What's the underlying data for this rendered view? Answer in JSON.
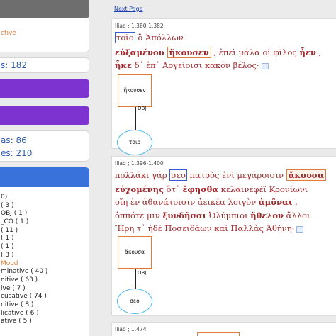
{
  "sidebar": {
    "active_label": "ctive",
    "count_label": "s: 182",
    "stats": [
      "as: 86",
      "es: 210"
    ],
    "facets": [
      "0)",
      "( 3 )",
      "OBJ ( 1 )",
      "_CO ( 1 )",
      "( 11 )",
      "( 1 )",
      "( 1 )",
      "( 3 )",
      "Mood",
      "minative ( 40 )",
      "nitive ( 63 )",
      "ive ( 7 )",
      "cusative ( 74 )",
      "nitive ( 8 )",
      "licative ( 6 )",
      "ative ( 5 )"
    ]
  },
  "main": {
    "next_page": "Next Page",
    "results": [
      {
        "ref": "Iliad ; 1.380-1.382",
        "lines": [
          {
            "parts": [
              {
                "t": "τοῖο",
                "s": "bx"
              },
              {
                "t": " ὃ Ἀπόλλων",
                "s": ""
              }
            ]
          },
          {
            "parts": [
              {
                "t": "εὐξαμένου ",
                "s": "b"
              },
              {
                "t": "ἤκουσεν",
                "s": "ob-b"
              },
              {
                "t": " , ἐπεὶ μάλα οἱ φίλος ",
                "s": ""
              },
              {
                "t": "ἦεν",
                "s": "b"
              },
              {
                "t": " ,",
                "s": ""
              }
            ]
          },
          {
            "parts": [
              {
                "t": "ἧκε",
                "s": "b"
              },
              {
                "t": " δ᾽ ἐπ᾽ Ἀργείοισι κακὸν βέλος·",
                "s": ""
              }
            ]
          }
        ],
        "tree": {
          "head": "ἤκουσεν",
          "relation": "OBJ",
          "dependent": "τοῖο"
        }
      },
      {
        "ref": "Iliad ; 1.396-1.400",
        "lines": [
          {
            "parts": [
              {
                "t": "πολλάκι γάρ ",
                "s": ""
              },
              {
                "t": "σεο",
                "s": "bx"
              },
              {
                "t": " πατρὸς ἐνὶ μεγάροισιν ",
                "s": ""
              },
              {
                "t": "ἄκουσα",
                "s": "obf-b"
              }
            ]
          },
          {
            "parts": [
              {
                "t": "εὐχομένης",
                "s": "b"
              },
              {
                "t": " ὅτ᾽ ",
                "s": ""
              },
              {
                "t": "ἔφησθα",
                "s": "b"
              },
              {
                "t": " κελαινεφέϊ Κρονίωνι",
                "s": ""
              }
            ]
          },
          {
            "parts": [
              {
                "t": "οἴη ἐν ἀθανάτοισιν ἀεικέα λοιγὸν ",
                "s": ""
              },
              {
                "t": "ἀμῦναι",
                "s": "b"
              },
              {
                "t": " ,",
                "s": ""
              }
            ]
          },
          {
            "parts": [
              {
                "t": "ὁππότε μιν ",
                "s": ""
              },
              {
                "t": "ξυνδῆσαι",
                "s": "b"
              },
              {
                "t": " Ὀλύμπιοι ",
                "s": ""
              },
              {
                "t": "ἤθελον",
                "s": "b"
              },
              {
                "t": " ἄλλοι",
                "s": ""
              }
            ]
          },
          {
            "parts": [
              {
                "t": "Ἥρη τ᾽ ἠδὲ Ποσειδάων καὶ Παλλὰς Ἀθήνη·",
                "s": ""
              }
            ]
          }
        ],
        "tree": {
          "head": "ἄκουσα",
          "relation": "OBJ",
          "dependent": "σεο"
        }
      },
      {
        "ref": "Iliad ; 1.474"
      }
    ]
  }
}
